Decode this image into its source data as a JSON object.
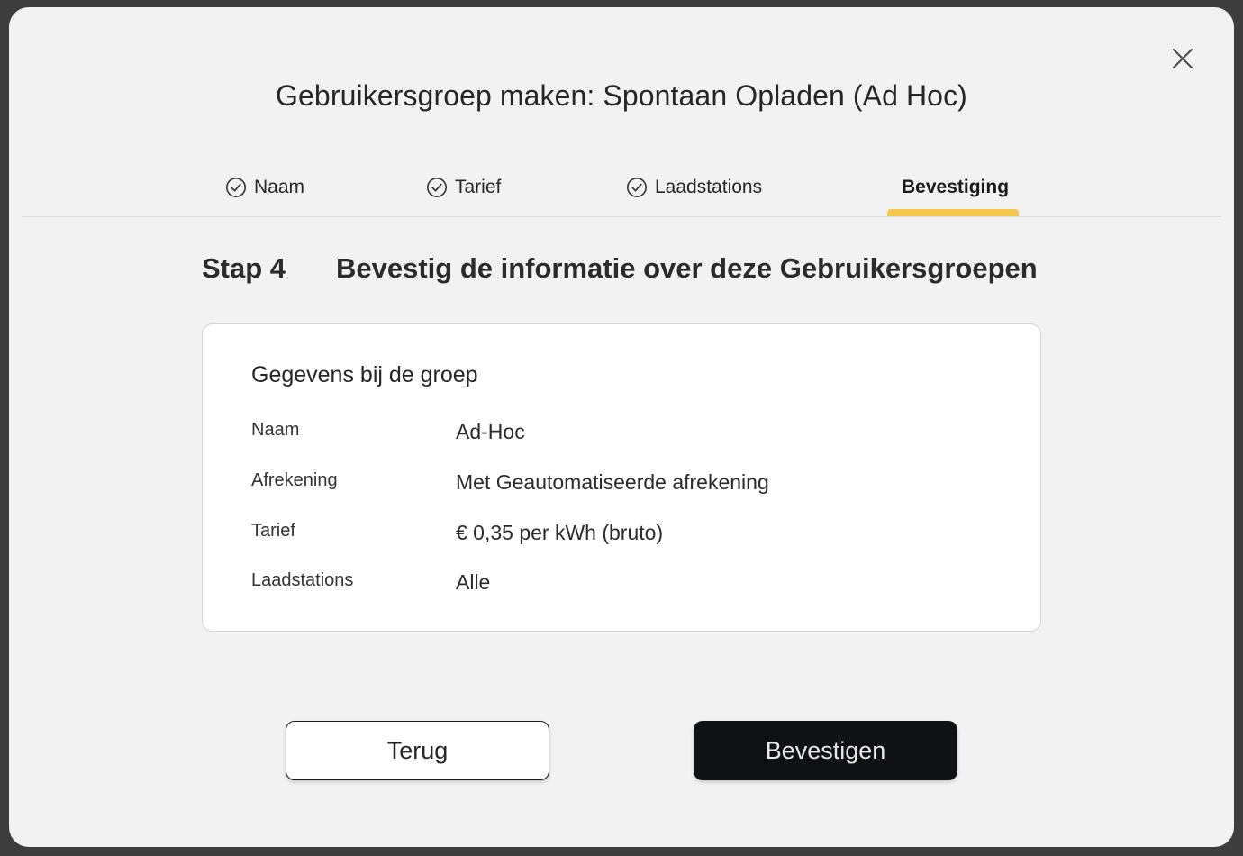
{
  "modal": {
    "title": "Gebruikersgroep maken: Spontaan Opladen (Ad Hoc)",
    "close_icon": "close-icon"
  },
  "tabs": [
    {
      "label": "Naam",
      "icon": "check-circle-icon",
      "state": "completed"
    },
    {
      "label": "Tarief",
      "icon": "check-circle-icon",
      "state": "completed"
    },
    {
      "label": "Laadstations",
      "icon": "check-circle-icon",
      "state": "completed"
    },
    {
      "label": "Bevestiging",
      "icon": "",
      "state": "active"
    }
  ],
  "step": {
    "number": "Stap 4",
    "title": "Bevestig de informatie over deze Gebruikersgroepen"
  },
  "card": {
    "title": "Gegevens bij de groep",
    "rows": [
      {
        "label": "Naam",
        "value": "Ad-Hoc"
      },
      {
        "label": "Afrekening",
        "value": "Met Geautomatiseerde afrekening"
      },
      {
        "label": "Tarief",
        "value": "€ 0,35 per kWh (bruto)"
      },
      {
        "label": "Laadstations",
        "value": "Alle"
      }
    ]
  },
  "buttons": {
    "back_label": "Terug",
    "confirm_label": "Bevestigen"
  },
  "colors": {
    "accent": "#f4c84a",
    "primary_button": "#0f1115",
    "modal_background": "#f2f2f2",
    "backdrop": "#3d3d3d"
  }
}
